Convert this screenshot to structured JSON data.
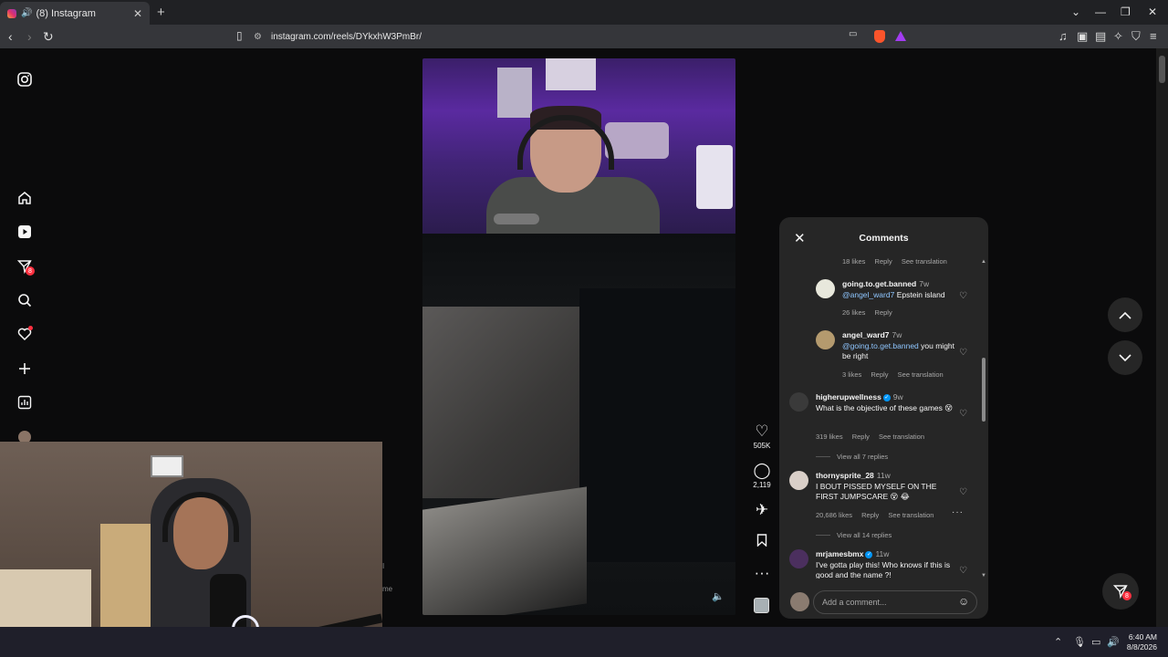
{
  "browser": {
    "tab_title": "(8) Instagram",
    "tab_audio_icon": "speaker-icon",
    "new_tab": "+",
    "url": "instagram.com/reels/DYkxhW3PmBr/",
    "window_controls": [
      "⌄",
      "—",
      "❐",
      "✕"
    ]
  },
  "sidebar": {
    "items": [
      {
        "name": "instagram-logo-icon",
        "glyph": "◎"
      },
      {
        "name": "home-icon",
        "glyph": "⌂"
      },
      {
        "name": "reels-icon",
        "glyph": "▶"
      },
      {
        "name": "messages-icon",
        "glyph": "✈",
        "badge": "8"
      },
      {
        "name": "search-icon",
        "glyph": "⚲"
      },
      {
        "name": "notifications-icon",
        "glyph": "♡"
      },
      {
        "name": "create-icon",
        "glyph": "+"
      },
      {
        "name": "dashboard-icon",
        "glyph": "▥"
      }
    ]
  },
  "reel": {
    "actions": {
      "likes": "505K",
      "comments": "2,119"
    }
  },
  "comments_panel": {
    "title": "Comments",
    "top_meta": {
      "likes": "18 likes",
      "reply": "Reply",
      "translate": "See translation"
    },
    "comments": [
      {
        "user": "going.to.get.banned",
        "time": "7w",
        "mention": "@angel_ward7",
        "text": "Epstein island",
        "likes": "26 likes",
        "reply": "Reply"
      },
      {
        "user": "angel_ward7",
        "time": "7w",
        "mention": "@going.to.get.banned",
        "text": "you might be right",
        "likes": "3 likes",
        "reply": "Reply",
        "translate": "See translation"
      },
      {
        "user": "higherupwellness",
        "time": "9w",
        "verified": true,
        "text": "What is the objective of these games 😵",
        "likes": "319 likes",
        "reply": "Reply",
        "translate": "See translation",
        "view_replies": "View all 7 replies"
      },
      {
        "user": "thornysprite_28",
        "time": "11w",
        "text": "I BOUT PISSED MYSELF ON THE FIRST JUMPSCARE 😵 😂",
        "likes": "20,686 likes",
        "reply": "Reply",
        "translate": "See translation",
        "view_replies": "View all 14 replies"
      },
      {
        "user": "mrjamesbmx",
        "time": "11w",
        "verified": true,
        "text": "I've gotta play this! Who knows if this is good and the name ?!"
      }
    ],
    "add_comment_placeholder": "Add a comment..."
  },
  "webcam_side_text": [
    "I",
    "me"
  ],
  "taskbar": {
    "time": "6:40 AM",
    "date": "8/8/2026"
  },
  "colors": {
    "page_bg": "#0b0b0c",
    "panel_bg": "#262626",
    "badge": "#ff3040",
    "verified": "#0095f6"
  }
}
